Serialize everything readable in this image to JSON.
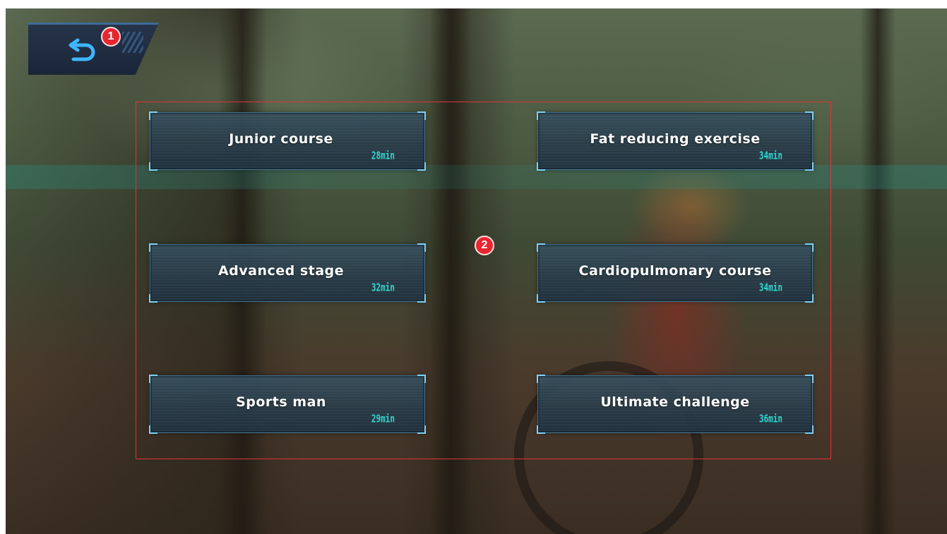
{
  "back_button": {
    "icon": "back-arrow-icon",
    "badge": "1"
  },
  "course_panel": {
    "badge": "2",
    "courses": [
      {
        "title": "Junior course",
        "duration": "28min"
      },
      {
        "title": "Fat reducing exercise",
        "duration": "34min"
      },
      {
        "title": "Advanced stage",
        "duration": "32min"
      },
      {
        "title": "Cardiopulmonary course",
        "duration": "34min"
      },
      {
        "title": "Sports man",
        "duration": "29min"
      },
      {
        "title": "Ultimate challenge",
        "duration": "36min"
      }
    ]
  },
  "colors": {
    "highlight": "#e0333b",
    "badge": "#e8262f",
    "duration": "#31d6d0",
    "card_border": "#7fd0f5"
  }
}
